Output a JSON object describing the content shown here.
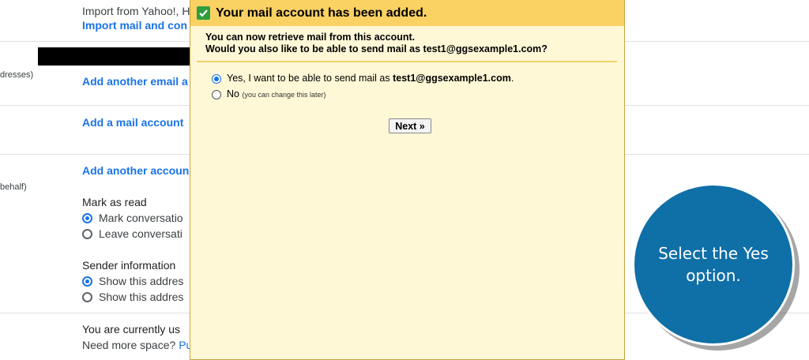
{
  "background": {
    "import_text": "Import from Yahoo!, H",
    "import_link": "Import mail and con",
    "side_addresses": "dresses)",
    "add_email_link": "Add another email a",
    "add_mail_account_link": "Add a mail account",
    "side_behalf": "behalf)",
    "add_account_link": "Add another accoun",
    "mark_as_read_heading": "Mark as read",
    "mark_option_1": "Mark conversatio",
    "mark_option_2": "Leave conversati",
    "sender_info_heading": "Sender information",
    "sender_option_1": "Show this addres",
    "sender_option_2": "Show this addres",
    "storage_line_1": "You are currently us",
    "storage_line_2_prefix": "Need more space? ",
    "storage_line_2_link": "Pu"
  },
  "dialog": {
    "title": "Your mail account has been added.",
    "line1": "You can now retrieve mail from this account.",
    "line2": "Would you also like to be able to send mail as test1@ggsexample1.com?",
    "option_yes_prefix": "Yes, I want to be able to send mail as ",
    "option_yes_email": "test1@ggsexample1.com",
    "option_yes_suffix": ".",
    "option_no": "No",
    "option_no_note": "(you can change this later)",
    "selected_option": "yes",
    "next_label": "Next »"
  },
  "callout": {
    "line1": "Select the Yes",
    "line2": "option."
  },
  "colors": {
    "dialog_header": "#fad163",
    "dialog_body": "#fff8d7",
    "link_blue": "#1a73e8",
    "callout_blue": "#0f6fa7",
    "check_green": "#2e9e3f"
  }
}
